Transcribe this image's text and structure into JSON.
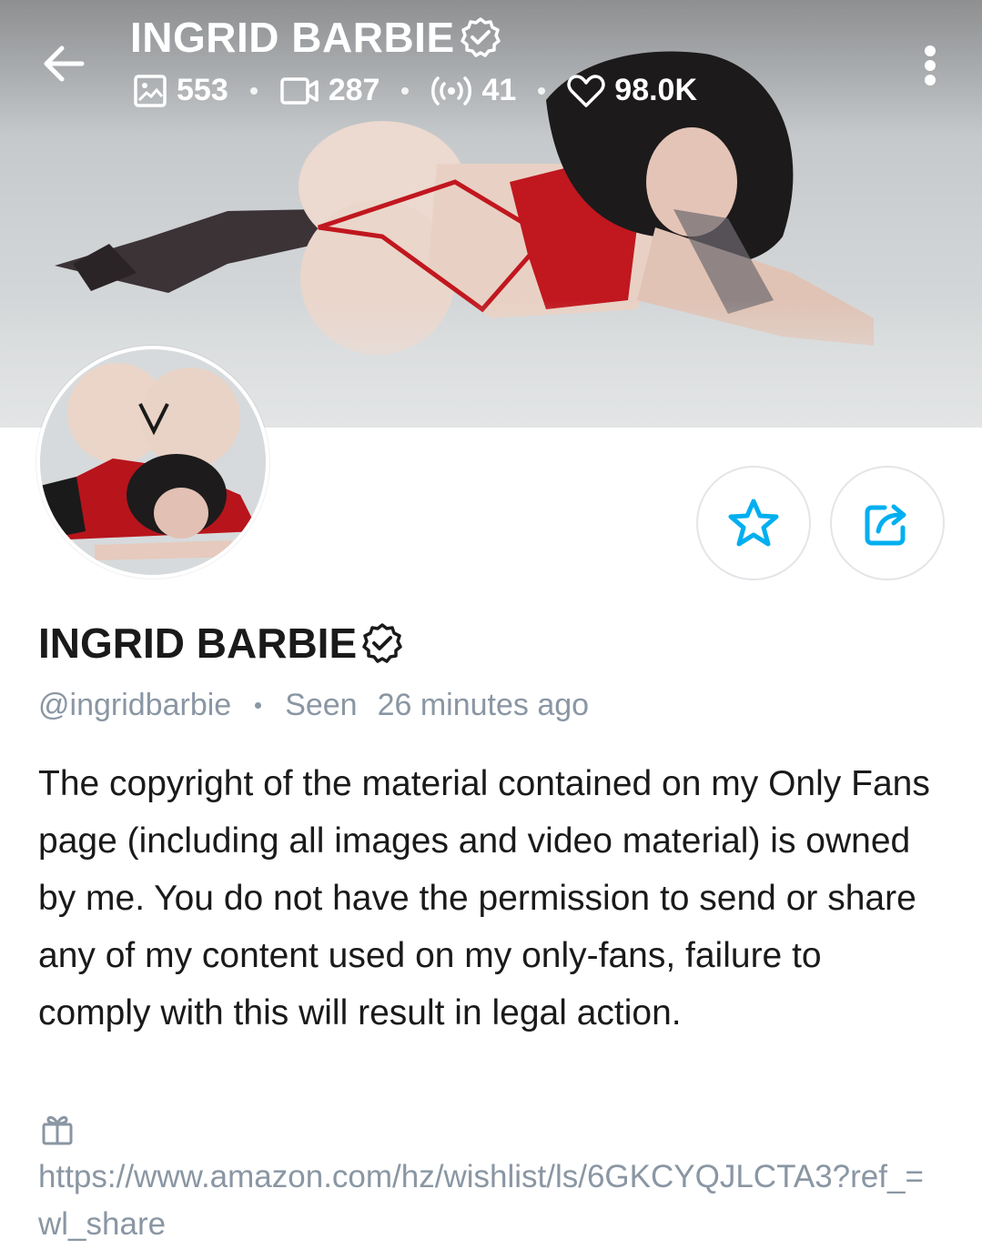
{
  "header": {
    "title": "INGRID BARBIE",
    "stats": {
      "photos": "553",
      "videos": "287",
      "streams": "41",
      "likes": "98.0K"
    }
  },
  "profile": {
    "name": "INGRID BARBIE",
    "handle": "@ingridbarbie",
    "seen_label": "Seen",
    "seen_time": "26 minutes ago",
    "bio": "The copyright of the material contained on my Only Fans page (including all images and video material) is owned by me. You do not have the permission to send or share any of my content used on my only-fans, failure to comply with this will result in legal action.",
    "wishlist_url": "https://www.amazon.com/hz/wishlist/ls/6GKCYQJLCTA3?ref_=wl_share"
  },
  "colors": {
    "accent": "#00aff0",
    "muted": "#8a96a3",
    "text": "#1a1a1a"
  },
  "icons": [
    "back-arrow-icon",
    "verified-badge-icon",
    "image-icon",
    "video-icon",
    "stream-icon",
    "heart-icon",
    "more-vertical-icon",
    "star-icon",
    "share-icon",
    "gift-icon"
  ]
}
